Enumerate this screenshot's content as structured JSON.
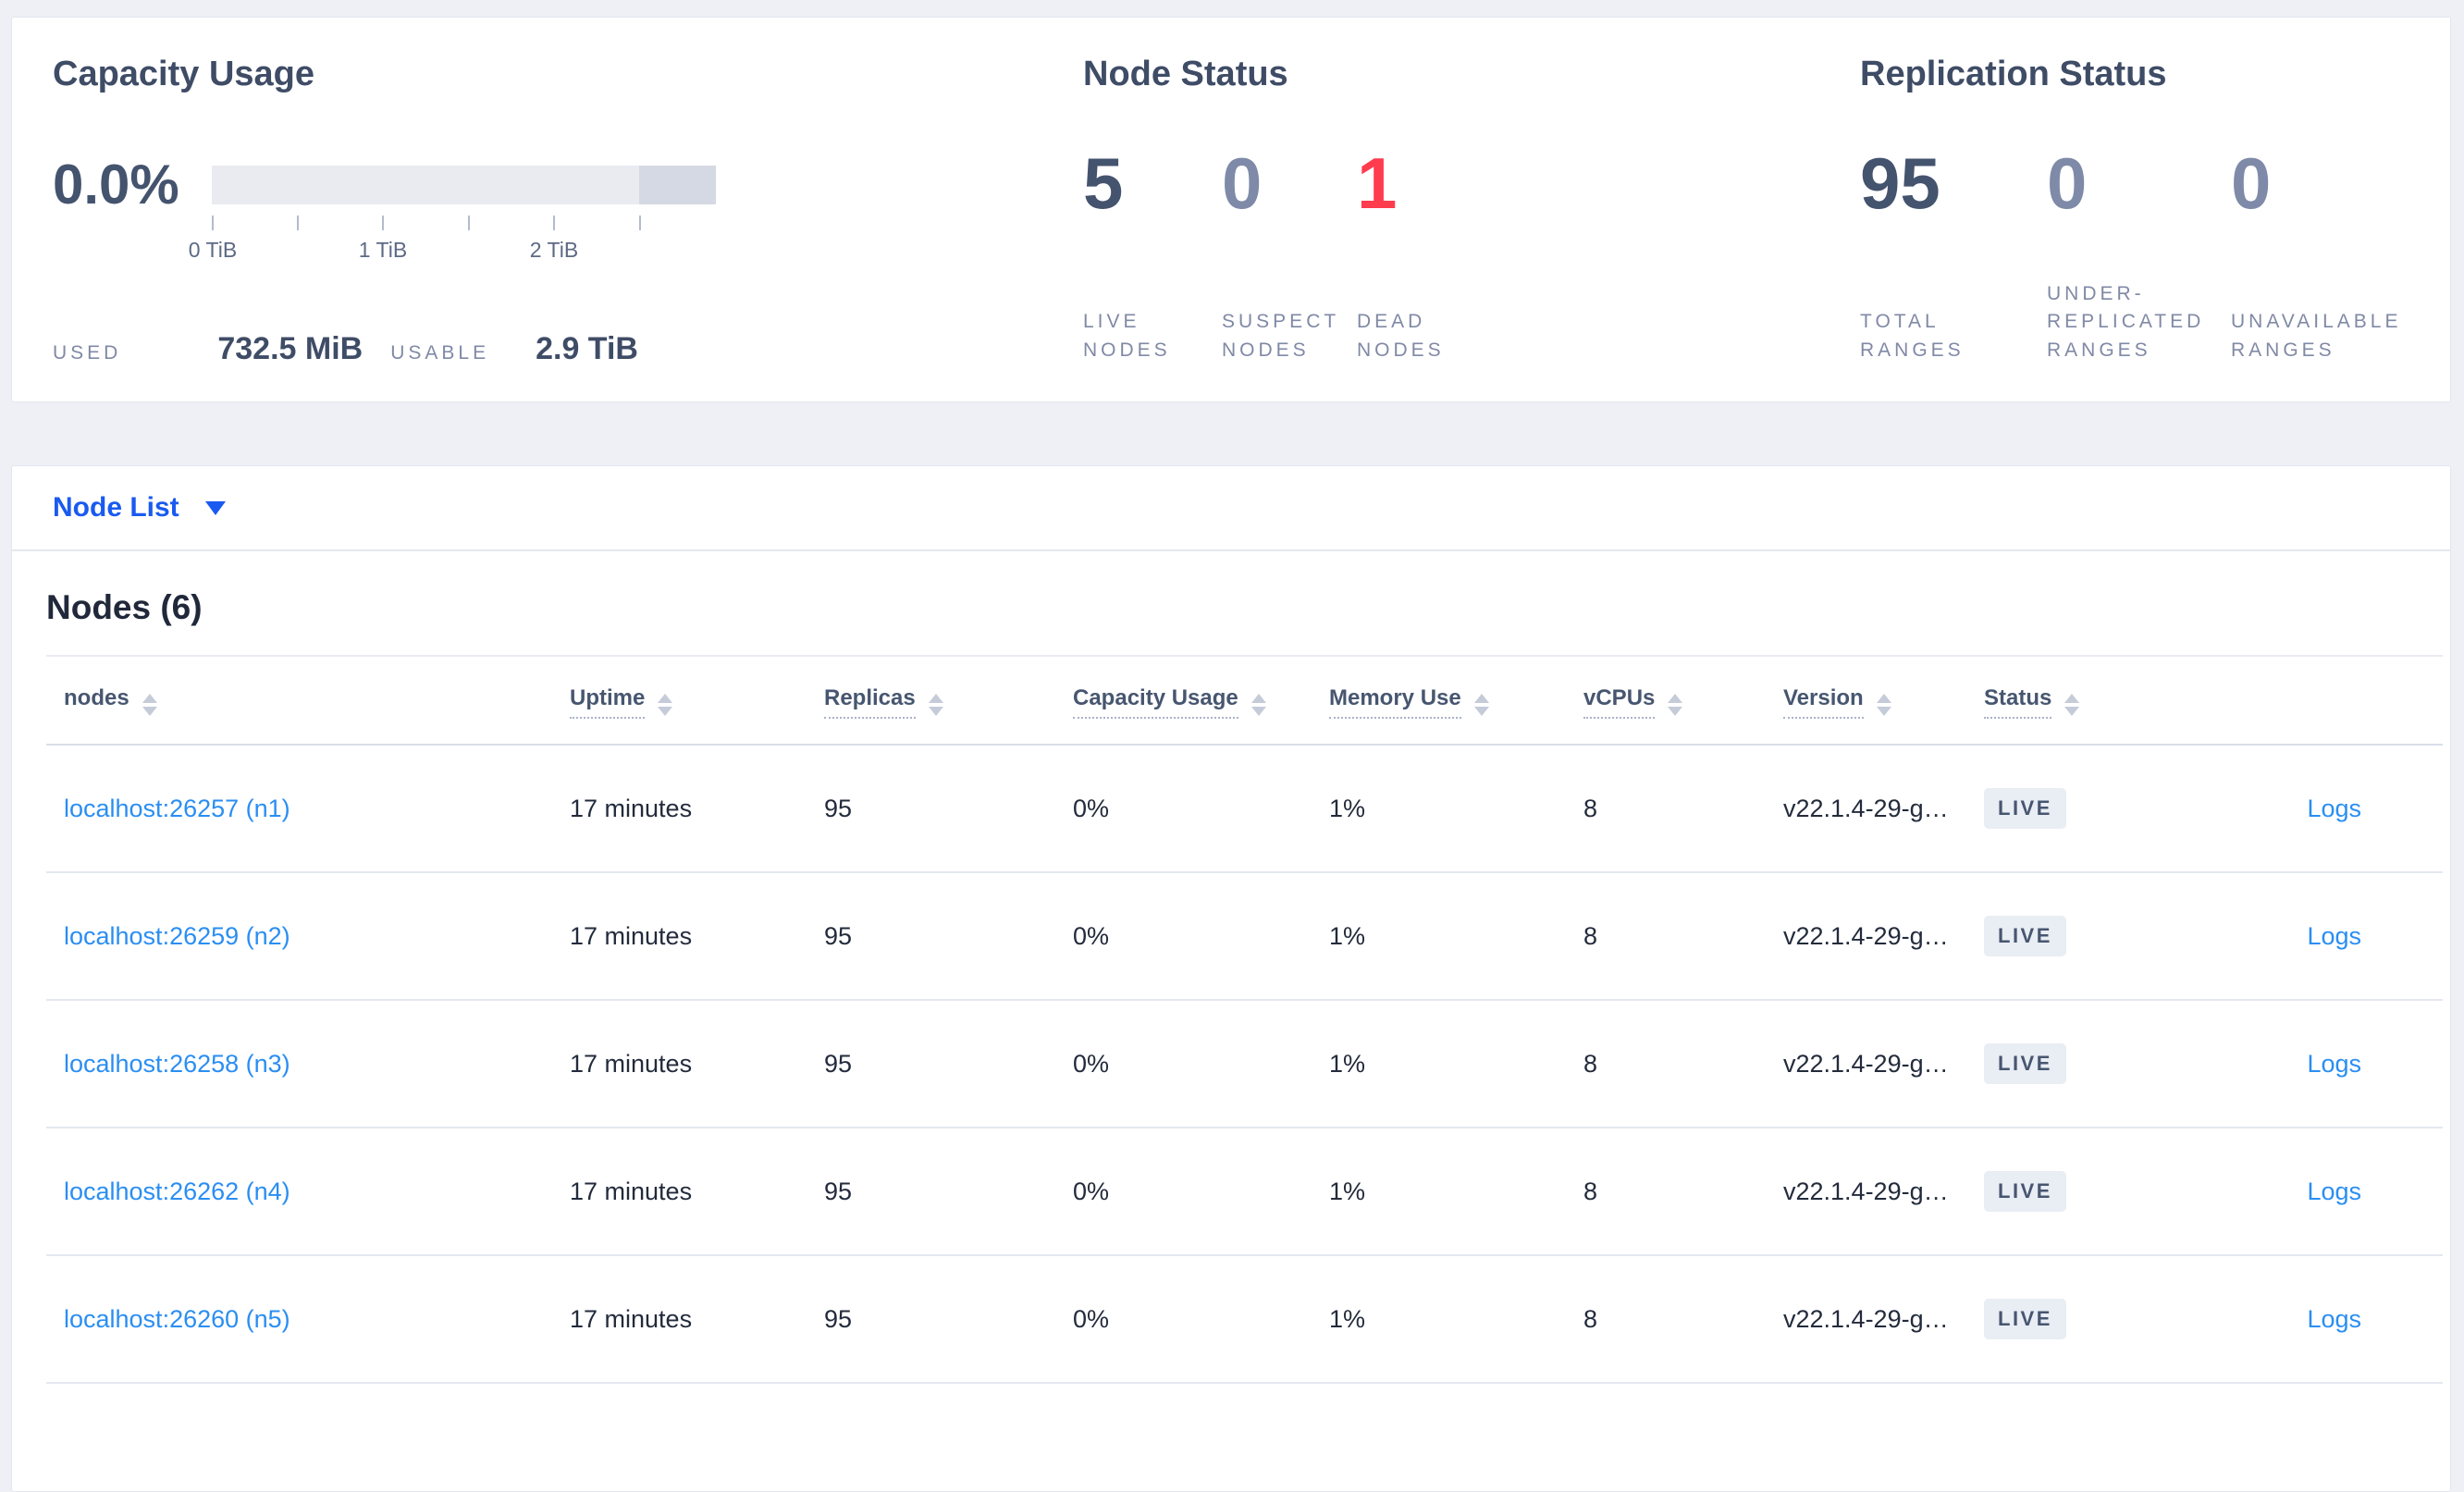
{
  "colors": {
    "link_blue": "#2a8ef2",
    "selector_blue": "#1a5af0",
    "dead_red": "#ff3b4e",
    "stat_dark": "#44536e",
    "stat_muted": "#7e8aa8",
    "badge_bg": "#e9edf4"
  },
  "overview": {
    "capacity": {
      "title": "Capacity Usage",
      "percent": "0.0%",
      "used_label": "USED",
      "used_value": "732.5 MiB",
      "usable_label": "USABLE",
      "usable_value": "2.9 TiB",
      "bar": {
        "tick_labels": [
          "0 TiB",
          "1 TiB",
          "2 TiB"
        ]
      }
    },
    "node_status": {
      "title": "Node Status",
      "stats": [
        {
          "value": "5",
          "label": "LIVE NODES",
          "color": "#44536e"
        },
        {
          "value": "0",
          "label": "SUSPECT NODES",
          "color": "#7e8aa8"
        },
        {
          "value": "1",
          "label": "DEAD NODES",
          "color": "#ff3b4e"
        }
      ]
    },
    "replication_status": {
      "title": "Replication Status",
      "stats": [
        {
          "value": "95",
          "label": "TOTAL RANGES",
          "color": "#44536e"
        },
        {
          "value": "0",
          "label": "UNDER-REPLICATED RANGES",
          "color": "#7e8aa8"
        },
        {
          "value": "0",
          "label": "UNAVAILABLE RANGES",
          "color": "#7e8aa8"
        }
      ]
    }
  },
  "node_list": {
    "selector_label": "Node List",
    "table_title": "Nodes (6)",
    "columns": [
      "nodes",
      "Uptime",
      "Replicas",
      "Capacity Usage",
      "Memory Use",
      "vCPUs",
      "Version",
      "Status"
    ],
    "logs_label": "Logs",
    "rows": [
      {
        "node": "localhost:26257 (n1)",
        "uptime": "17 minutes",
        "replicas": "95",
        "capacity_usage": "0%",
        "memory_use": "1%",
        "vcpus": "8",
        "version": "v22.1.4-29-g…",
        "status": "LIVE"
      },
      {
        "node": "localhost:26259 (n2)",
        "uptime": "17 minutes",
        "replicas": "95",
        "capacity_usage": "0%",
        "memory_use": "1%",
        "vcpus": "8",
        "version": "v22.1.4-29-g…",
        "status": "LIVE"
      },
      {
        "node": "localhost:26258 (n3)",
        "uptime": "17 minutes",
        "replicas": "95",
        "capacity_usage": "0%",
        "memory_use": "1%",
        "vcpus": "8",
        "version": "v22.1.4-29-g…",
        "status": "LIVE"
      },
      {
        "node": "localhost:26262 (n4)",
        "uptime": "17 minutes",
        "replicas": "95",
        "capacity_usage": "0%",
        "memory_use": "1%",
        "vcpus": "8",
        "version": "v22.1.4-29-g…",
        "status": "LIVE"
      },
      {
        "node": "localhost:26260 (n5)",
        "uptime": "17 minutes",
        "replicas": "95",
        "capacity_usage": "0%",
        "memory_use": "1%",
        "vcpus": "8",
        "version": "v22.1.4-29-g…",
        "status": "LIVE"
      }
    ]
  }
}
